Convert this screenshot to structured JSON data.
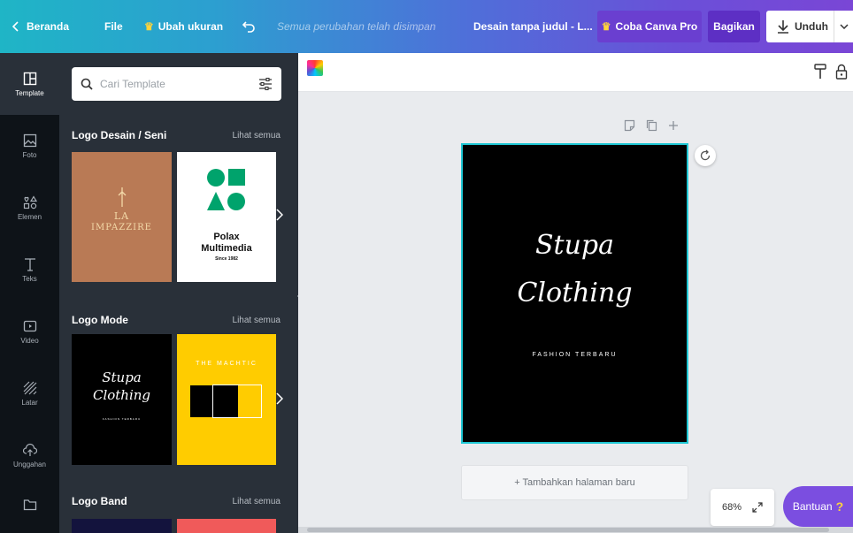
{
  "topbar": {
    "home_label": "Beranda",
    "file_label": "File",
    "resize_label": "Ubah ukuran",
    "saved_status": "Semua perubahan telah disimpan",
    "doc_name": "Desain tanpa judul - L...",
    "pro_label": "Coba Canva Pro",
    "share_label": "Bagikan",
    "download_label": "Unduh"
  },
  "sidenav": {
    "items": [
      {
        "label": "Template",
        "icon": "template-icon"
      },
      {
        "label": "Foto",
        "icon": "photo-icon"
      },
      {
        "label": "Elemen",
        "icon": "elements-icon"
      },
      {
        "label": "Teks",
        "icon": "text-icon"
      },
      {
        "label": "Video",
        "icon": "video-icon"
      },
      {
        "label": "Latar",
        "icon": "background-icon"
      },
      {
        "label": "Unggahan",
        "icon": "upload-icon"
      },
      {
        "label": "",
        "icon": "folder-icon"
      }
    ]
  },
  "search": {
    "placeholder": "Cari Template"
  },
  "sections": [
    {
      "title": "Logo Desain / Seni",
      "link": "Lihat semua"
    },
    {
      "title": "Logo Mode",
      "link": "Lihat semua"
    },
    {
      "title": "Logo Band",
      "link": "Lihat semua"
    }
  ],
  "thumbs": {
    "la": {
      "line1": "LA",
      "line2": "IMPAZZIRE"
    },
    "polax": {
      "line1": "Polax",
      "line2": "Multimedia",
      "line3": "Since 1982"
    },
    "stupa_small": {
      "line1": "Stupa",
      "line2": "Clothing",
      "line3": "FASHION TERBARU"
    },
    "machtic": {
      "line1": "THE MACHTIC"
    }
  },
  "design": {
    "title_line1": "Stupa",
    "title_line2": "Clothing",
    "subtitle": "FASHION TERBARU"
  },
  "editor": {
    "add_page_label": "+ Tambahkan halaman baru",
    "zoom": "68%",
    "help_label": "Bantuan",
    "help_mark": "?"
  },
  "colors": {
    "accent": "#7b4ee0",
    "selection": "#1fc7d4",
    "panel": "#293039",
    "la_bg": "#b97a55",
    "machtic_bg": "#ffcc00"
  }
}
